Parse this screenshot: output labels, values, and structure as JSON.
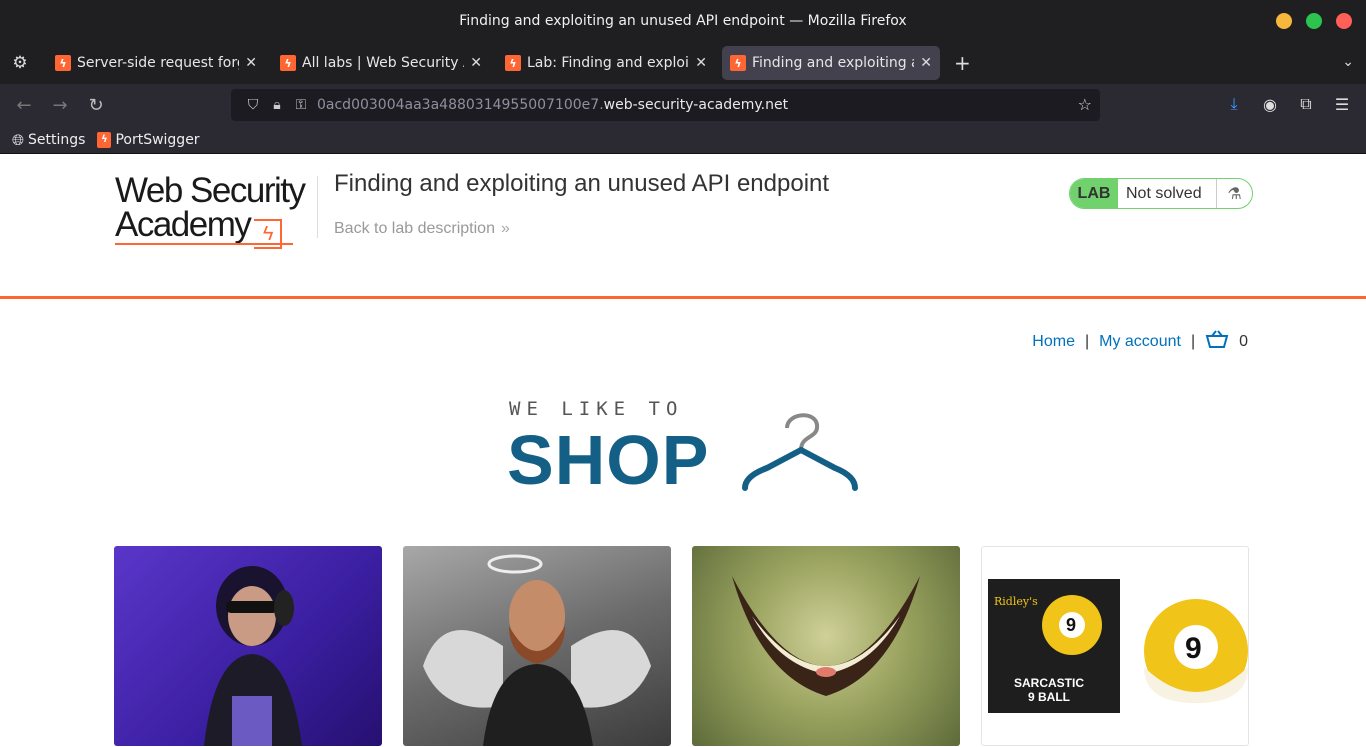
{
  "window": {
    "title": "Finding and exploiting an unused API endpoint — Mozilla Firefox",
    "controls": {
      "minimize_color": "#f6b73c",
      "maximize_color": "#2dc34f",
      "close_color": "#ff5f57"
    }
  },
  "tabs": [
    {
      "title": "Server-side request forge",
      "active": false
    },
    {
      "title": "All labs | Web Security Ac",
      "active": false
    },
    {
      "title": "Lab: Finding and exploitir",
      "active": false
    },
    {
      "title": "Finding and exploiting an",
      "active": true
    }
  ],
  "navbar": {
    "url_prefix": "0acd003004aa3a4880314955007100e7.",
    "url_domain": "web-security-academy.net"
  },
  "bookmarks": [
    {
      "label": "Settings",
      "icon": "globe-icon"
    },
    {
      "label": "PortSwigger",
      "icon": "portswigger-icon"
    }
  ],
  "academy": {
    "logo_line1": "Web Security",
    "logo_line2": "Academy",
    "lab_title": "Finding and exploiting an unused API endpoint",
    "back_link": "Back to lab description",
    "lab_badge": "LAB",
    "status": "Not solved"
  },
  "shop": {
    "nav": {
      "home": "Home",
      "account": "My account",
      "cart_count": "0"
    },
    "tagline": "WE LIKE TO",
    "brand": "SHOP"
  },
  "colors": {
    "accent": "#ff6633",
    "link": "#0071bc",
    "shop_brand": "#135f86",
    "lab_green": "#70d16d"
  },
  "product_card": {
    "brand": "Ridley's",
    "ball_number": "9",
    "name_line1": "SARCASTIC",
    "name_line2": "9 BALL"
  }
}
